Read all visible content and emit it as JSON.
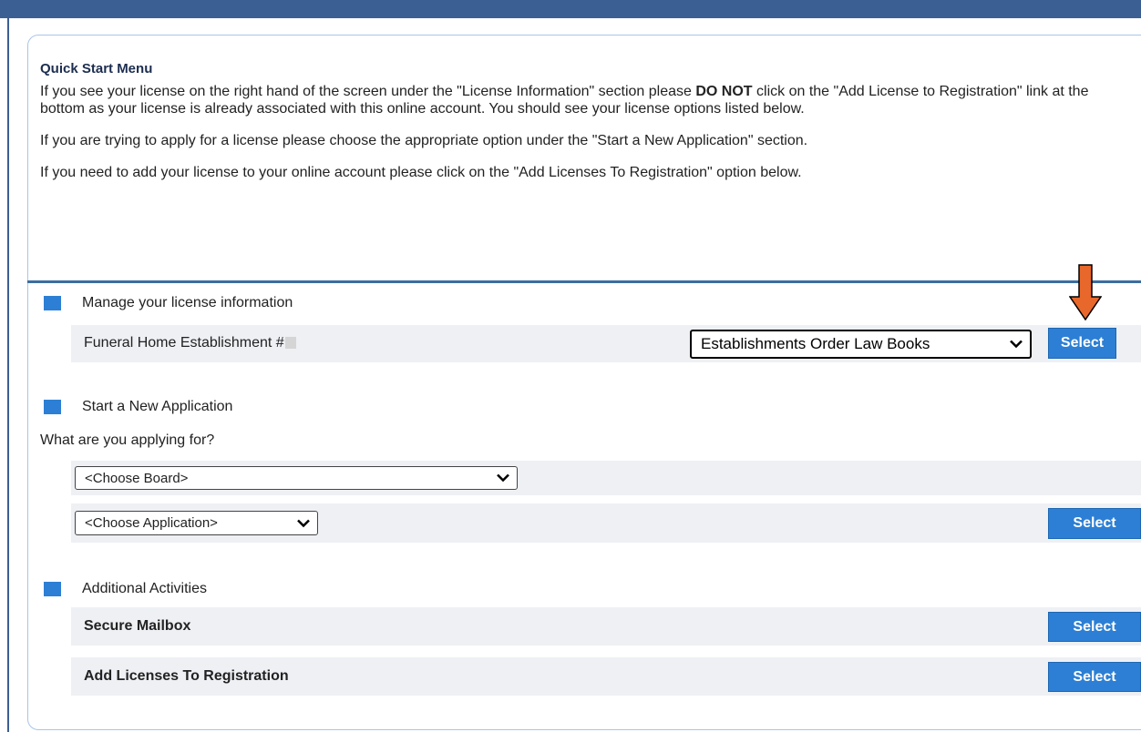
{
  "intro": {
    "title": "Quick Start Menu",
    "para1_a": "If you see your license on the right hand of the screen under the \"License Information\" section please ",
    "para1_strong": "DO NOT",
    "para1_b": " click on the \"Add License to Registration\" link at the bottom as your license is already associated with this online account. You should see your license options listed below.",
    "para2": "If you are trying to apply for a license please choose the appropriate option under the \"Start a New Application\" section.",
    "para3": "If you need to add your license to your online account please click on the \"Add Licenses To Registration\" option below."
  },
  "manage": {
    "heading": "Manage your license information",
    "license_label": "Funeral Home Establishment  #",
    "option_selected": "Establishments Order Law Books",
    "select_label": "Select"
  },
  "new_app": {
    "heading": "Start a New Application",
    "question": "What are you applying for?",
    "board_selected": "<Choose Board>",
    "application_selected": "<Choose Application>",
    "select_label": "Select"
  },
  "additional": {
    "heading": "Additional Activities",
    "items": [
      {
        "label": "Secure Mailbox",
        "button": "Select"
      },
      {
        "label": "Add Licenses To Registration",
        "button": "Select"
      }
    ]
  },
  "colors": {
    "accent": "#2c7fd4",
    "header": "#3b5f93",
    "arrow": "#e8672a"
  },
  "icons": [
    "chevron-down-icon",
    "down-arrow-icon",
    "section-square-icon"
  ]
}
